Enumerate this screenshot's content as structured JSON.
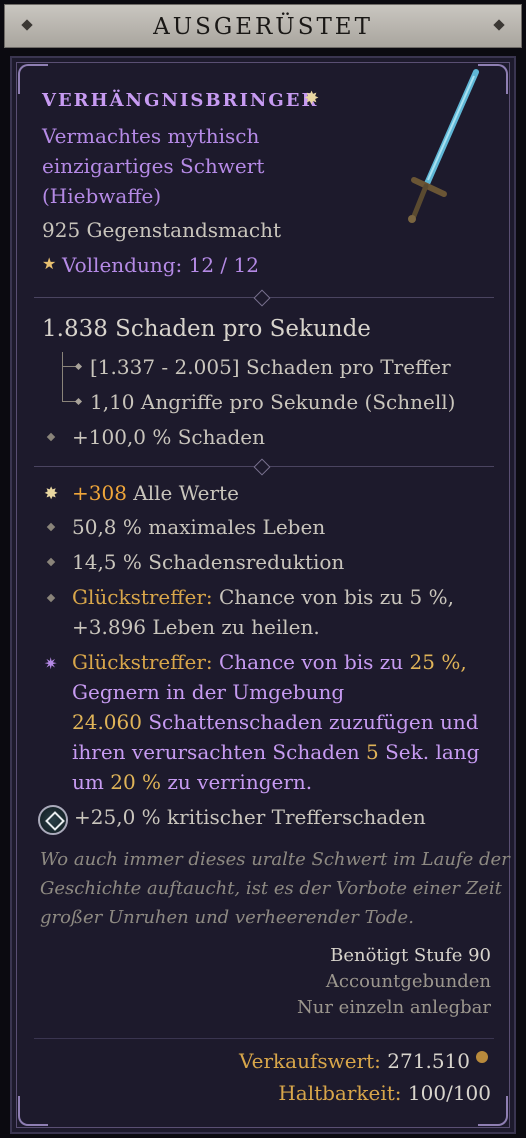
{
  "header": {
    "title": "AUSGERÜSTET"
  },
  "item": {
    "name": "VERHÄNGNISBRINGER",
    "type_lines": [
      "Vermachtes mythisch",
      "einzigartiges Schwert",
      "(Hiebwaffe)"
    ],
    "item_power": "925 Gegenstandsmacht",
    "mastery": "Vollendung: 12 / 12"
  },
  "weapon": {
    "dps": "1.838 Schaden pro Sekunde",
    "damage_per_hit": "[1.337 - 2.005] Schaden pro Treffer",
    "attack_speed": "1,10 Angriffe pro Sekunde (Schnell)",
    "implicit": "+100,0 % Schaden"
  },
  "affixes": {
    "all_stats_value": "+308",
    "all_stats_label": "Alle Werte",
    "max_life": "50,8 % maximales Leben",
    "damage_reduction": "14,5 % Schadensreduktion",
    "lucky_hit_label": "Glückstreffer:",
    "lucky_hit_text_1": "Chance von bis zu 5 %,",
    "lucky_hit_text_2": "+3.896 Leben zu heilen.",
    "unique": {
      "l1_label": "Glückstreffer:",
      "l1_text": "Chance von bis zu",
      "l1_value": "25 %,",
      "l2": "Gegnern in der Umgebung",
      "l3_value": "24.060",
      "l3_text": "Schattenschaden zuzufügen und",
      "l4_text_a": "ihren verursachten Schaden",
      "l4_value": "5",
      "l4_text_b": "Sek. lang",
      "l5_text_a": "um",
      "l5_value": "20 %",
      "l5_text_b": "zu verringern."
    },
    "crit": "+25,0 % kritischer Trefferschaden"
  },
  "flavor": [
    "Wo auch immer dieses uralte Schwert im Laufe der",
    "Geschichte auftaucht, ist es der Vorbote einer Zeit",
    "großer Unruhen und verheerender Tode."
  ],
  "requirements": {
    "level": "Benötigt Stufe 90",
    "account_bound": "Accountgebunden",
    "unique_equipped": "Nur einzeln anlegbar"
  },
  "footer": {
    "sell_label": "Verkaufswert:",
    "sell_value": "271.510",
    "durability_label": "Haltbarkeit:",
    "durability_value": "100/100"
  },
  "icons": [
    "star-icon",
    "sword-icon",
    "coin-icon",
    "aspect-icon",
    "sparkle-icon"
  ],
  "colors": {
    "unique": "#c79bf2",
    "orange": "#f0a63a",
    "gold": "#d8a64a"
  }
}
